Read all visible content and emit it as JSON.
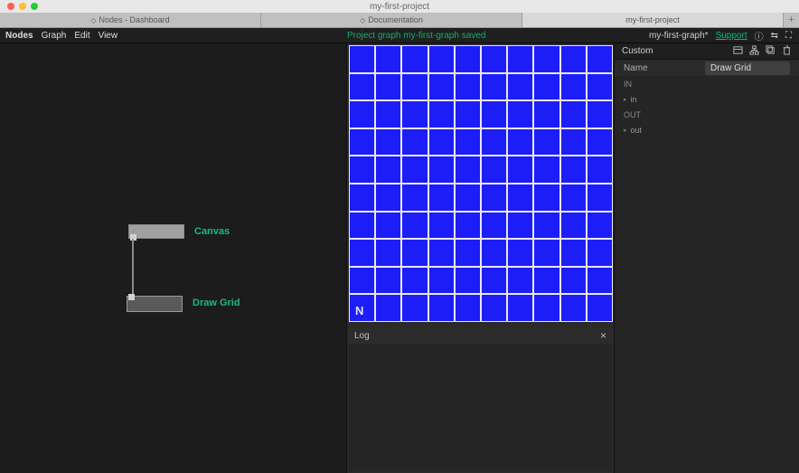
{
  "window": {
    "title": "my-first-project"
  },
  "tabs": [
    {
      "label": "Nodes - Dashboard",
      "icon": "◇"
    },
    {
      "label": "Documentation",
      "icon": "◇"
    },
    {
      "label": "my-first-project",
      "icon": ""
    }
  ],
  "menubar": {
    "items": [
      "Nodes",
      "Graph",
      "Edit",
      "View"
    ],
    "status": "Project graph my-first-graph saved",
    "graph_name": "my-first-graph*",
    "support": "Support"
  },
  "canvas": {
    "nodes": [
      {
        "id": "canvas",
        "label": "Canvas"
      },
      {
        "id": "drawgrid",
        "label": "Draw Grid"
      }
    ]
  },
  "preview": {
    "grid_cols": 10,
    "grid_rows": 10,
    "color": "#1d1df7",
    "logo": "N"
  },
  "log": {
    "title": "Log"
  },
  "inspector": {
    "header": "Custom",
    "name_key": "Name",
    "name_value": "Draw Grid",
    "in_section": "IN",
    "in_ports": [
      "in"
    ],
    "out_section": "OUT",
    "out_ports": [
      "out"
    ]
  }
}
